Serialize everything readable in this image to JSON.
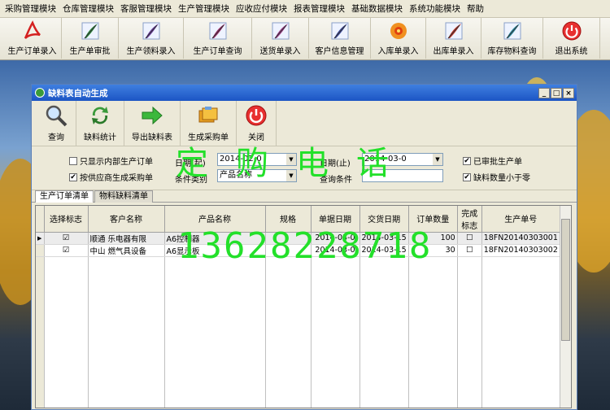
{
  "menu": [
    "采购管理模块",
    "仓库管理模块",
    "客服管理模块",
    "生产管理模块",
    "应收应付模块",
    "报表管理模块",
    "基础数据模块",
    "系统功能模块",
    "帮助"
  ],
  "toolbar": [
    {
      "label": "生产订单录入",
      "icon": "acrobat-pdf-icon",
      "color": "#d42020"
    },
    {
      "label": "生产单审批",
      "icon": "feather-pen-icon",
      "color": "#2a8a3a"
    },
    {
      "label": "生产领料录入",
      "icon": "feather-pen-icon",
      "color": "#6a3aa0"
    },
    {
      "label": "生产订单查询",
      "icon": "feather-pen-icon",
      "color": "#a02a6a"
    },
    {
      "label": "送货单录入",
      "icon": "feather-pen-icon",
      "color": "#a03a8a"
    },
    {
      "label": "客户信息管理",
      "icon": "feather-pen-icon",
      "color": "#3a4aa0"
    },
    {
      "label": "入库单录入",
      "icon": "flower-icon",
      "color": "#e0801a"
    },
    {
      "label": "出库单录入",
      "icon": "feather-pen-icon",
      "color": "#c03020"
    },
    {
      "label": "库存物料查询",
      "icon": "feather-pen-icon",
      "color": "#2a8aa0"
    },
    {
      "label": "退出系统",
      "icon": "power-icon",
      "color": "#d42020"
    }
  ],
  "window": {
    "title": "缺料表自动生成",
    "controls": [
      "_",
      "□",
      "×"
    ],
    "toolbar": [
      {
        "label": "查询",
        "icon": "magnifier-icon"
      },
      {
        "label": "缺料统计",
        "icon": "recycle-arrows-icon"
      },
      {
        "label": "导出缺料表",
        "icon": "green-arrow-icon"
      },
      {
        "label": "生成采购单",
        "icon": "folders-icon"
      },
      {
        "label": "关闭",
        "icon": "power-icon"
      }
    ],
    "filters": {
      "only_internal": {
        "label": "只显示内部生产订单",
        "checked": false
      },
      "by_supplier": {
        "label": "按供应商生成采购单",
        "checked": true
      },
      "date_from_label": "日期(起)",
      "date_from": "2014-02-0",
      "condition_type_label": "条件类别",
      "condition_type": "产品名称",
      "date_to_label": "日期(止)",
      "date_to": "2014-03-0",
      "query_condition_label": "查询条件",
      "query_condition": "",
      "approved_only": {
        "label": "已审批生产单",
        "checked": true
      },
      "qty_less_than_zero": {
        "label": "缺料数量小于零",
        "checked": true
      }
    },
    "tabs": [
      {
        "label": "生产订单清单",
        "active": true
      },
      {
        "label": "物料缺料清单",
        "active": false
      }
    ],
    "grid": {
      "columns": [
        "选择标志",
        "客户名称",
        "产品名称",
        "规格",
        "单据日期",
        "交货日期",
        "订单数量",
        "完成标志",
        "生产单号"
      ],
      "rows": [
        {
          "selected": true,
          "customer": "顺通 乐电器有限",
          "product": "A6控制器",
          "spec": "",
          "doc_date": "2014-03-0",
          "delivery": "2014-03-15",
          "qty": "100",
          "done": false,
          "order_no": "18FN20140303001"
        },
        {
          "selected": true,
          "customer": "中山 燃气具设备",
          "product": "A6显示板",
          "spec": "",
          "doc_date": "2014-03-0",
          "delivery": "2014-03-15",
          "qty": "30",
          "done": false,
          "order_no": "18FN20140303002"
        }
      ]
    }
  },
  "watermark": {
    "title": "定购电话",
    "phone": "13628228718",
    "color": "#23e02a"
  }
}
